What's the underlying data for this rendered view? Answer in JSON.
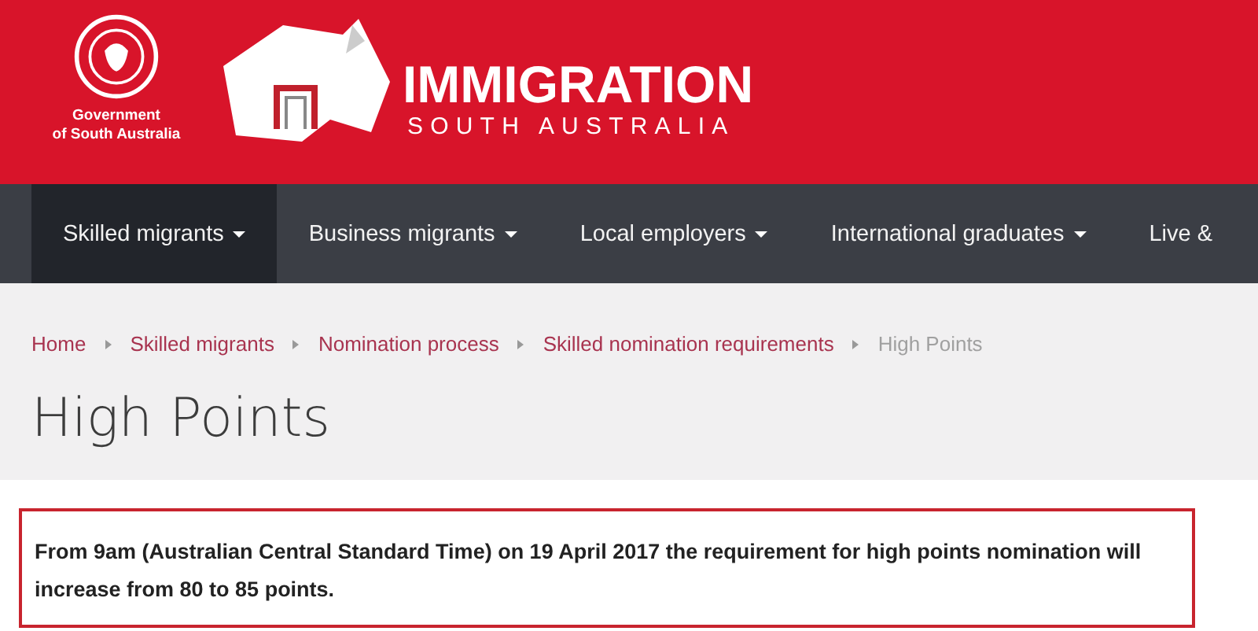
{
  "header": {
    "government": [
      "Government",
      "of South Australia"
    ],
    "brand": "IMMIGRATION",
    "brand_sub": "SOUTH AUSTRALIA"
  },
  "nav": [
    {
      "label": "Skilled migrants",
      "selected": true,
      "caret": true
    },
    {
      "label": "Business migrants",
      "selected": false,
      "caret": true
    },
    {
      "label": "Local employers",
      "selected": false,
      "caret": true
    },
    {
      "label": "International graduates",
      "selected": false,
      "caret": true
    },
    {
      "label": "Live &",
      "selected": false,
      "caret": false
    }
  ],
  "breadcrumb": [
    {
      "label": "Home",
      "current": false
    },
    {
      "label": "Skilled migrants",
      "current": false
    },
    {
      "label": "Nomination process",
      "current": false
    },
    {
      "label": "Skilled nomination requirements",
      "current": false
    },
    {
      "label": "High Points",
      "current": true
    }
  ],
  "title": "High Points",
  "notice": "From 9am (Australian Central Standard Time) on 19 April 2017 the requirement for high points nomination will increase from 80 to 85 points."
}
